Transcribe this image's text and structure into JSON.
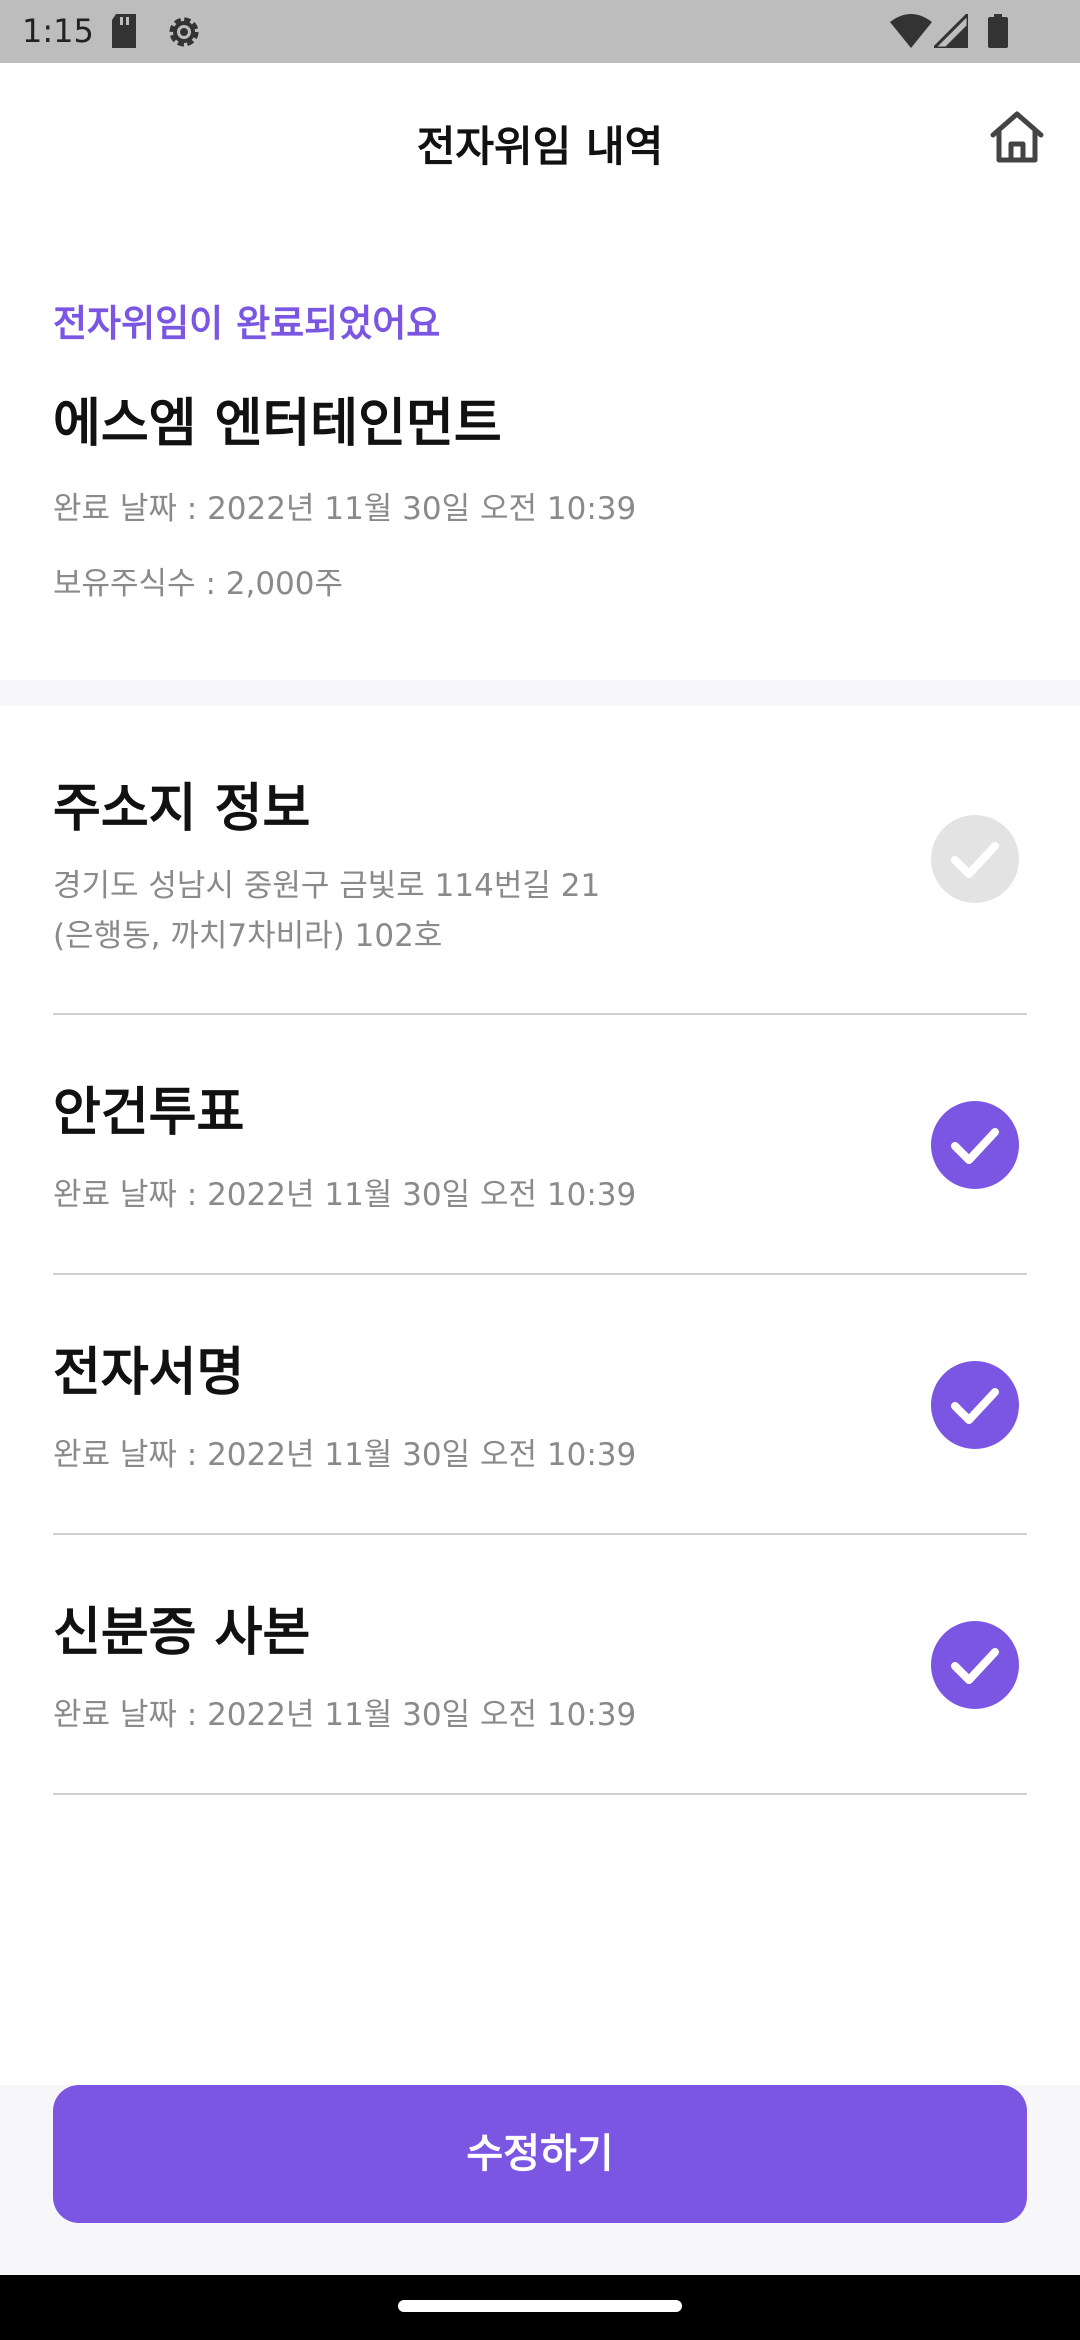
{
  "status_bar": {
    "time": "1:15",
    "icons": [
      "sd-card-icon",
      "settings-gear-icon",
      "wifi-icon",
      "signal-icon",
      "battery-icon"
    ]
  },
  "header": {
    "title": "전자위임 내역",
    "home_icon": "home-icon"
  },
  "summary": {
    "status_text": "전자위임이 완료되었어요",
    "company": "에스엠 엔터테인먼트",
    "completed_date": "완료 날짜 : 2022년 11월 30일 오전 10:39",
    "shares": "보유주식수 : 2,000주"
  },
  "items": [
    {
      "title": "주소지 정보",
      "line1": "경기도 성남시 중원구 금빛로 114번길 21",
      "line2": "(은행동, 까치7차비라) 102호",
      "checked": false
    },
    {
      "title": "안건투표",
      "line1": "완료 날짜 : 2022년 11월 30일 오전 10:39",
      "checked": true
    },
    {
      "title": "전자서명",
      "line1": "완료 날짜 : 2022년 11월 30일 오전 10:39",
      "checked": true
    },
    {
      "title": "신분증 사본",
      "line1": "완료 날짜 : 2022년 11월 30일 오전 10:39",
      "checked": true
    }
  ],
  "footer": {
    "edit_button_label": "수정하기"
  },
  "colors": {
    "accent": "#7b56e2",
    "unchecked": "#e3e3e3",
    "muted_text": "#8a8a8a"
  }
}
